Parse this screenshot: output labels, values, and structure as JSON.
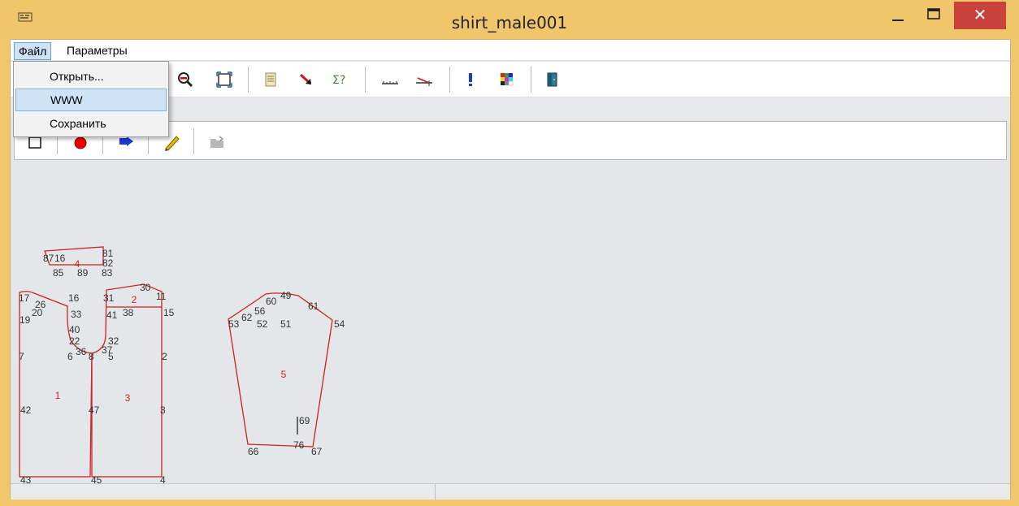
{
  "window": {
    "title": "shirt_male001",
    "min_label": "—",
    "close_label": "✕"
  },
  "menu": {
    "file": "Файл",
    "params": "Параметры"
  },
  "file_menu": {
    "open": "Открыть...",
    "www": "WWW",
    "save": "Сохранить"
  },
  "colors": {
    "titlebar": "#f1c56a",
    "close": "#c8413b",
    "pattern": "#d22020",
    "highlight": "#cfe3f6"
  },
  "toolbar": {
    "icons": [
      "zoom-out-icon",
      "fit-window-icon",
      "document-icon",
      "arrow-icon",
      "sum-query-icon",
      "measure-icon",
      "measure-angle-icon",
      "exclamation-icon",
      "palette-icon",
      "exit-door-icon"
    ]
  },
  "toolbar2": {
    "icons": [
      "new-piece-icon",
      "record-point-icon",
      "move-arrow-icon",
      "pencil-icon",
      "folder-icon"
    ]
  },
  "pattern": {
    "piece_labels": [
      "1",
      "2",
      "3",
      "4",
      "5"
    ],
    "point_labels": [
      "87",
      "16",
      "81",
      "82",
      "85",
      "89",
      "83",
      "30",
      "17",
      "16",
      "31",
      "11",
      "15",
      "26",
      "20",
      "19",
      "33",
      "41",
      "38",
      "40",
      "22",
      "32",
      "37",
      "36",
      "6",
      "8",
      "5",
      "7",
      "2",
      "42",
      "47",
      "3",
      "43",
      "45",
      "4",
      "49",
      "60",
      "56",
      "62",
      "61",
      "53",
      "52",
      "51",
      "54",
      "69",
      "66",
      "76",
      "67"
    ]
  }
}
